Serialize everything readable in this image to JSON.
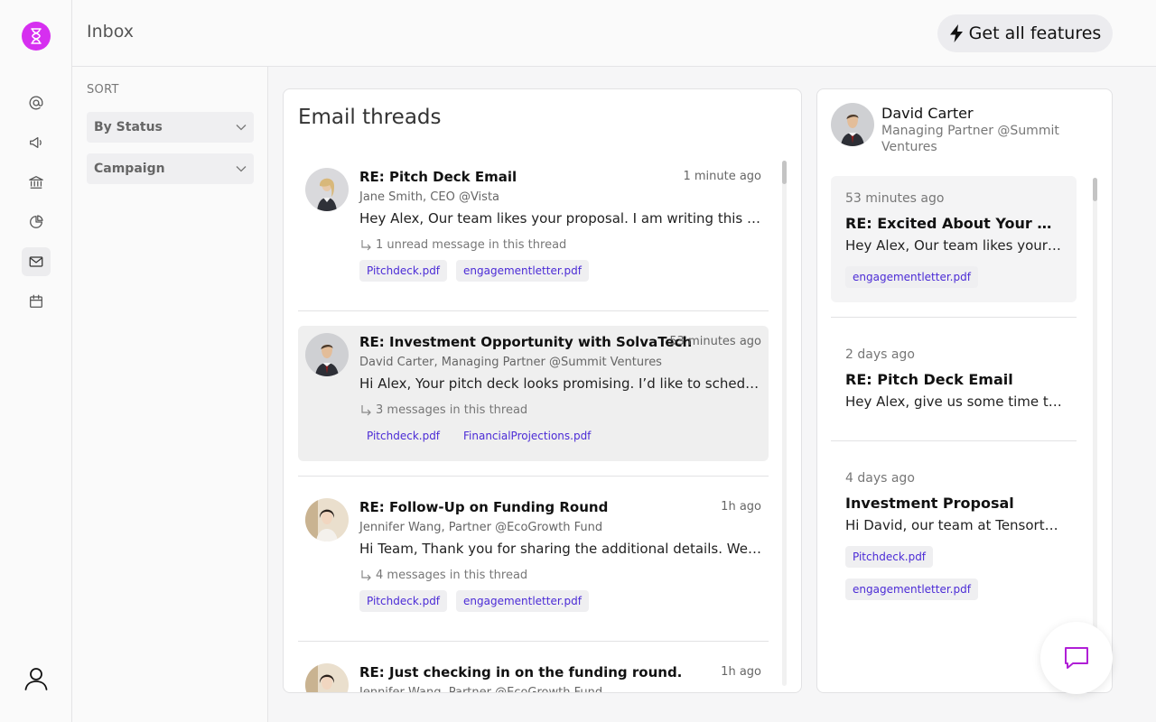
{
  "app": {
    "page_title": "Inbox",
    "brand_color": "#d62ff0",
    "accent_link_color": "#4b2bd6"
  },
  "header": {
    "features_button": {
      "label": "Get all features",
      "icon": "lightning-icon"
    }
  },
  "rail": {
    "items": [
      {
        "name": "at-sign-icon",
        "active": false
      },
      {
        "name": "megaphone-icon",
        "active": false
      },
      {
        "name": "bank-icon",
        "active": false
      },
      {
        "name": "pie-chart-icon",
        "active": false
      },
      {
        "name": "mail-icon",
        "active": true
      },
      {
        "name": "calendar-icon",
        "active": false
      }
    ],
    "user_icon": "user-icon",
    "logo_icon": "hourglass-icon"
  },
  "sort": {
    "label": "SORT",
    "filters": [
      {
        "label": "By Status"
      },
      {
        "label": "Campaign"
      }
    ]
  },
  "threads": {
    "title": "Email threads",
    "items": [
      {
        "subject": "RE: Pitch Deck Email",
        "time": "1 minute ago",
        "from": "Jane Smith, CEO @Vista",
        "preview": "Hey Alex, Our team likes your proposal. I am writing this to let you know",
        "count": "1 unread message in this thread",
        "attachments": [
          "Pitchdeck.pdf",
          "engagementletter.pdf"
        ],
        "selected": false
      },
      {
        "subject": "RE: Investment Opportunity with SolvaTech",
        "time": "53 minutes ago",
        "from": "David Carter, Managing Partner @Summit Ventures",
        "preview": "Hi Alex, Your pitch deck looks promising. I’d like to schedule a call",
        "count": "3 messages in this thread",
        "attachments": [
          "Pitchdeck.pdf",
          "FinancialProjections.pdf"
        ],
        "selected": true
      },
      {
        "subject": "RE: Follow-Up on Funding Round",
        "time": "1h ago",
        "from": "Jennifer Wang, Partner @EcoGrowth Fund",
        "preview": "Hi Team, Thank you for sharing the additional details. We’re reviewing",
        "count": "4 messages in this thread",
        "attachments": [
          "Pitchdeck.pdf",
          "engagementletter.pdf"
        ],
        "selected": false
      },
      {
        "subject": "RE: Just checking in on the funding round.",
        "time": "1h ago",
        "from": "Jennifer Wang, Partner @EcoGrowth Fund",
        "preview": "",
        "count": "",
        "attachments": [],
        "selected": false
      }
    ]
  },
  "detail": {
    "name": "David Carter",
    "role": "Managing Partner @Summit Ventures",
    "messages": [
      {
        "time": "53 minutes ago",
        "subject": "RE: Excited About Your Proposal",
        "preview": "Hey Alex, Our team likes your proposal",
        "attachments": [
          "engagementletter.pdf"
        ]
      },
      {
        "time": "2 days ago",
        "subject": "RE: Pitch Deck Email",
        "preview": "Hey Alex, give us some time to review",
        "attachments": []
      },
      {
        "time": "4 days ago",
        "subject": "Investment Proposal",
        "preview": "Hi David, our team at Tensortech",
        "attachments": [
          "Pitchdeck.pdf",
          "engagementletter.pdf"
        ]
      }
    ]
  },
  "chat": {
    "icon": "chat-bubble-icon"
  }
}
